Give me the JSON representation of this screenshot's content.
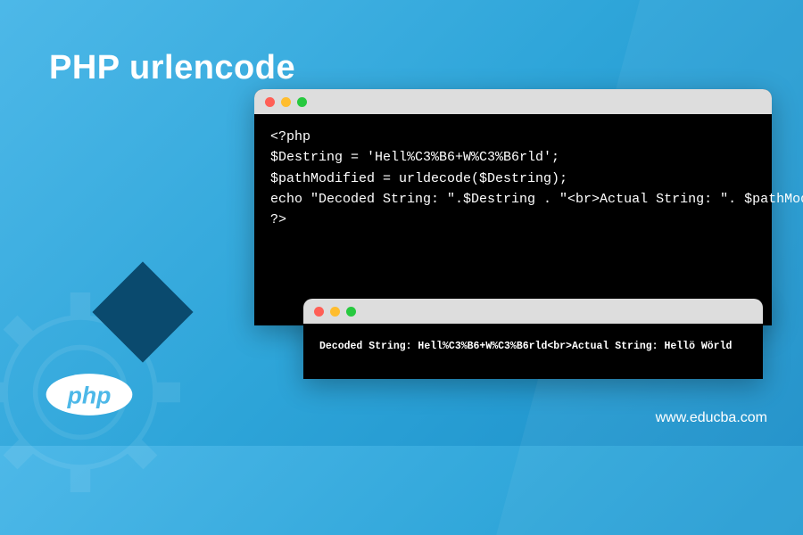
{
  "title": "PHP urlencode",
  "window1": {
    "line1": "<?php",
    "line2": "$Destring = 'Hell%C3%B6+W%C3%B6rld';",
    "line3": "$pathModified = urldecode($Destring);",
    "line4": "echo \"Decoded String: \".$Destring . \"<br>Actual String: \". $pathModified;",
    "line5": "?>"
  },
  "window2": {
    "output": "Decoded String: Hell%C3%B6+W%C3%B6rld<br>Actual String: Hellö Wörld"
  },
  "logo_text": "php",
  "website": "www.educba.com"
}
